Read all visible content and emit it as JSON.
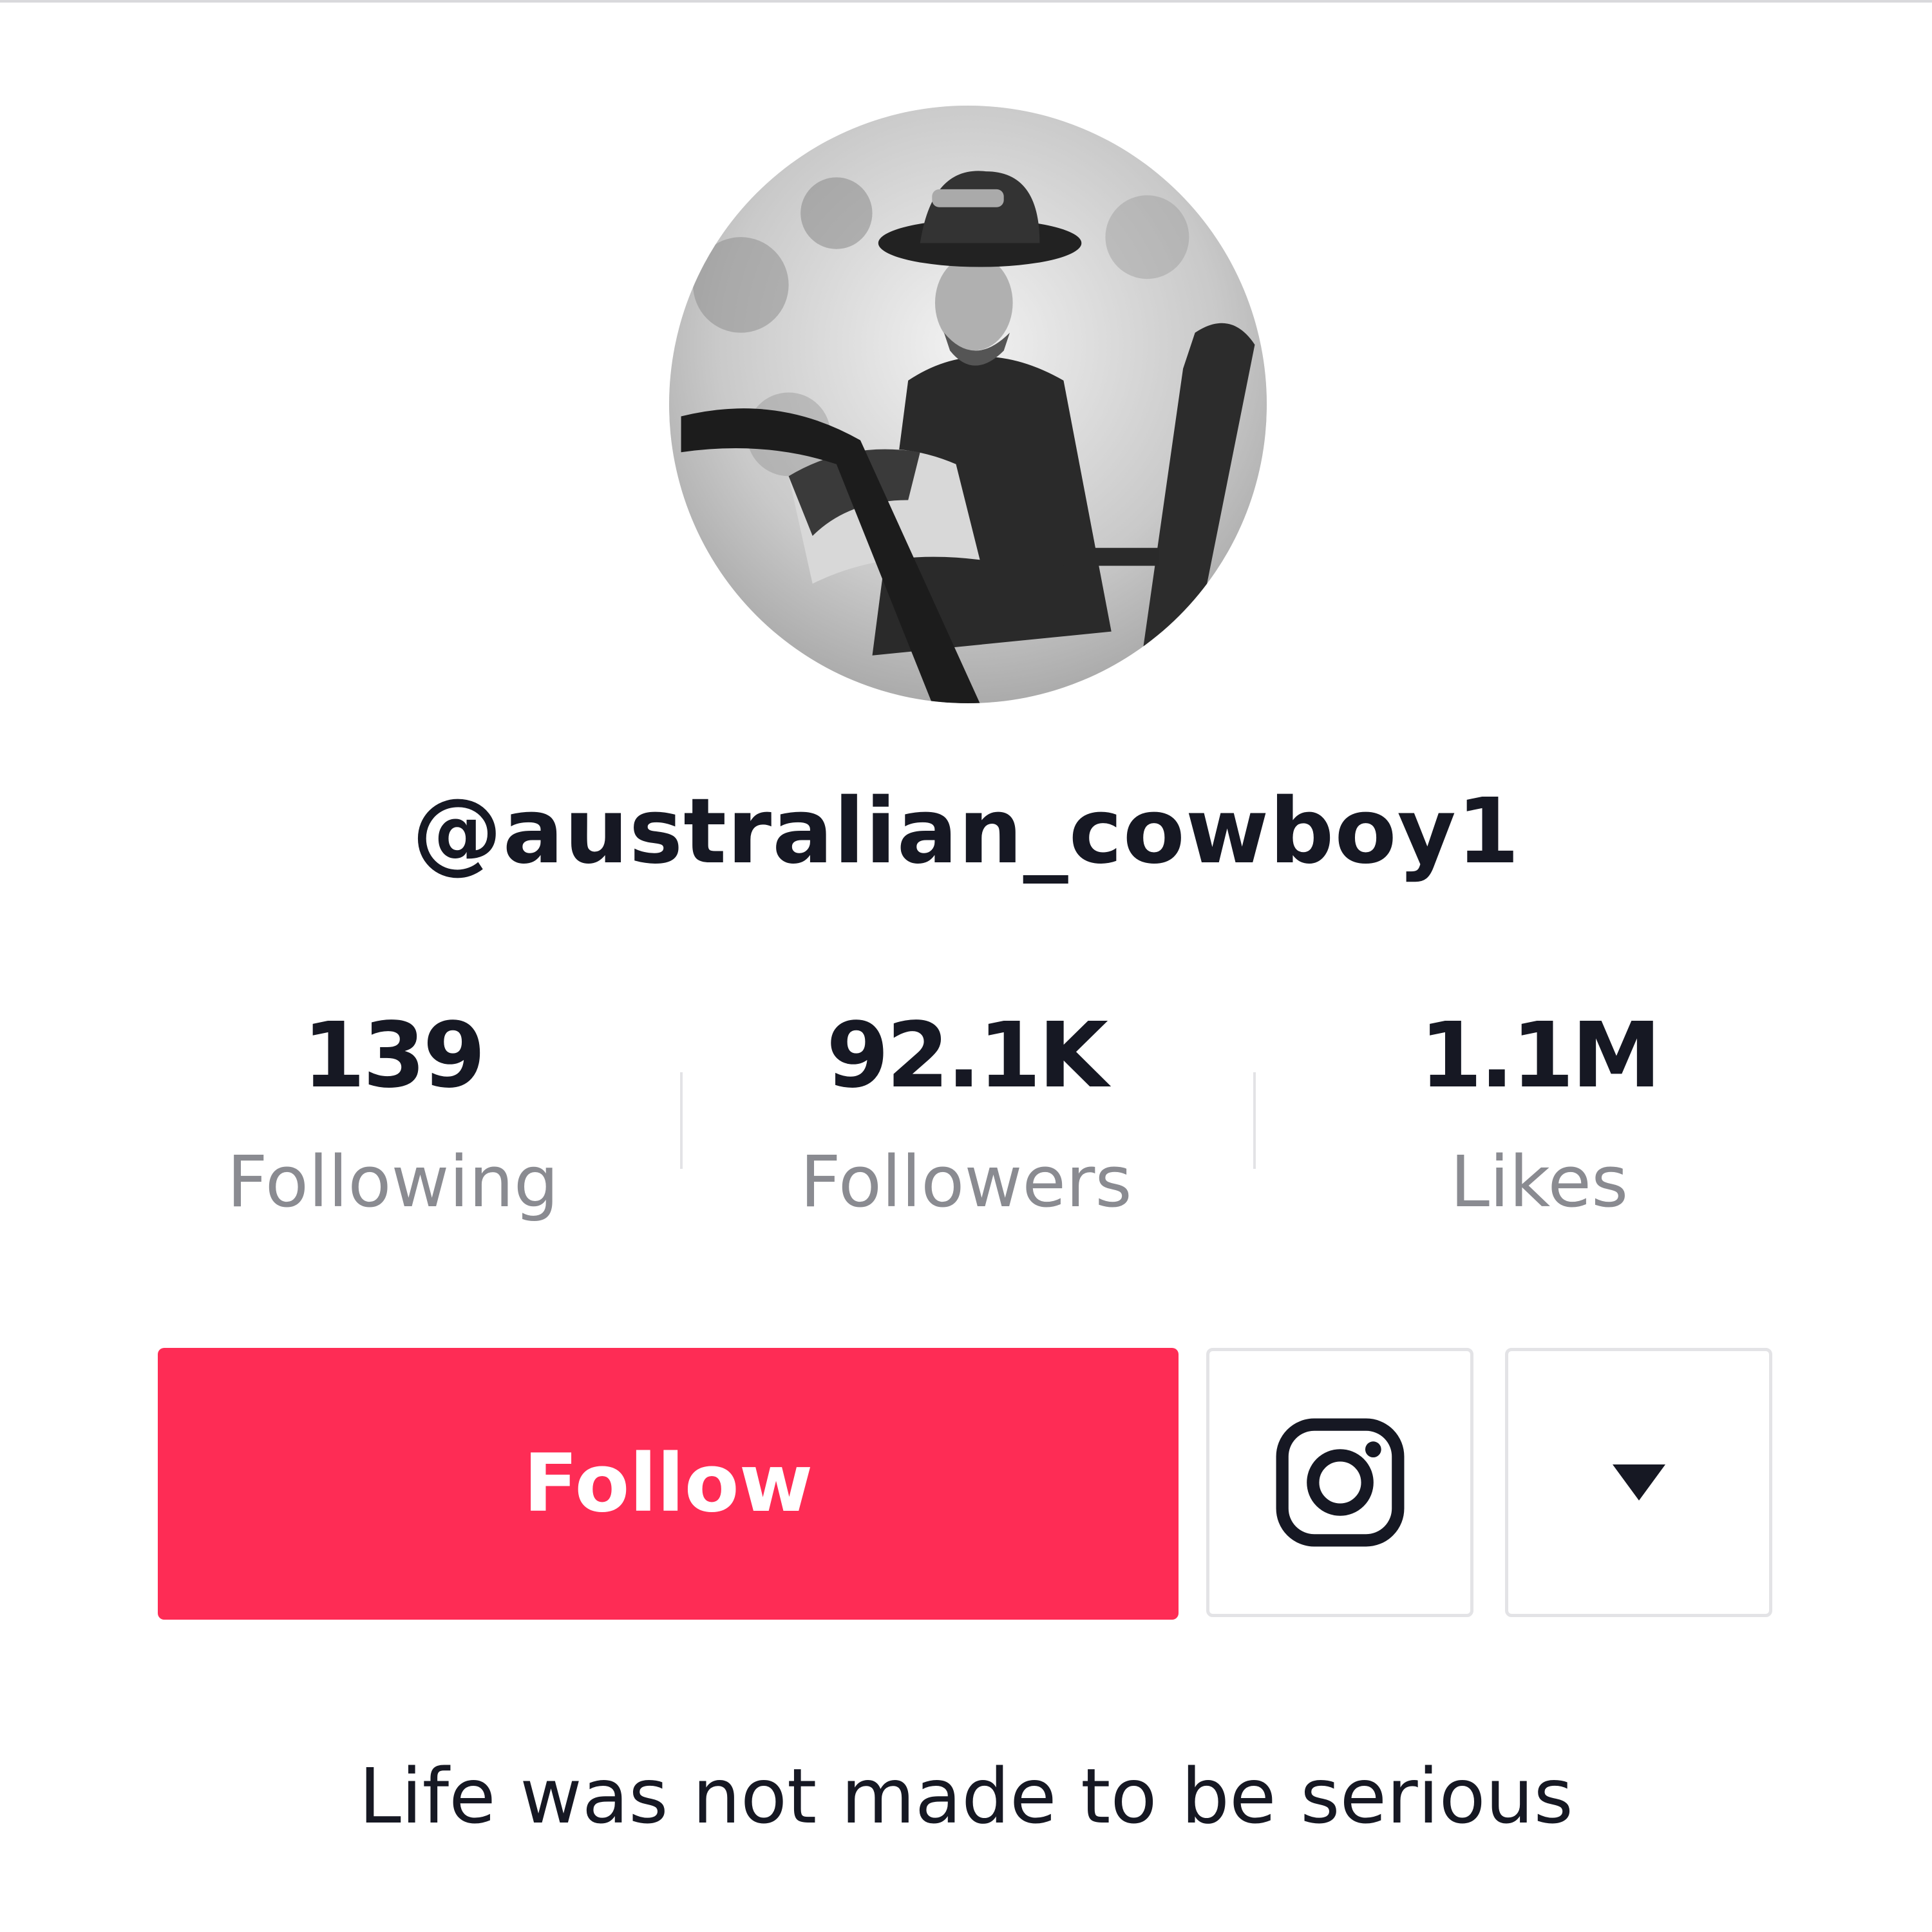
{
  "profile": {
    "username": "@australian_cowboy1",
    "bio": "Life was not made to be serious"
  },
  "stats": {
    "following": {
      "value": "139",
      "label": "Following"
    },
    "followers": {
      "value": "92.1K",
      "label": "Followers"
    },
    "likes": {
      "value": "1.1M",
      "label": "Likes"
    }
  },
  "actions": {
    "follow_label": "Follow",
    "social_icon": "instagram-icon",
    "more_icon": "caret-down-icon"
  },
  "colors": {
    "accent": "#fe2c55",
    "text_primary": "#161823",
    "text_secondary": "#8a8b91",
    "border": "#e3e3e6"
  }
}
